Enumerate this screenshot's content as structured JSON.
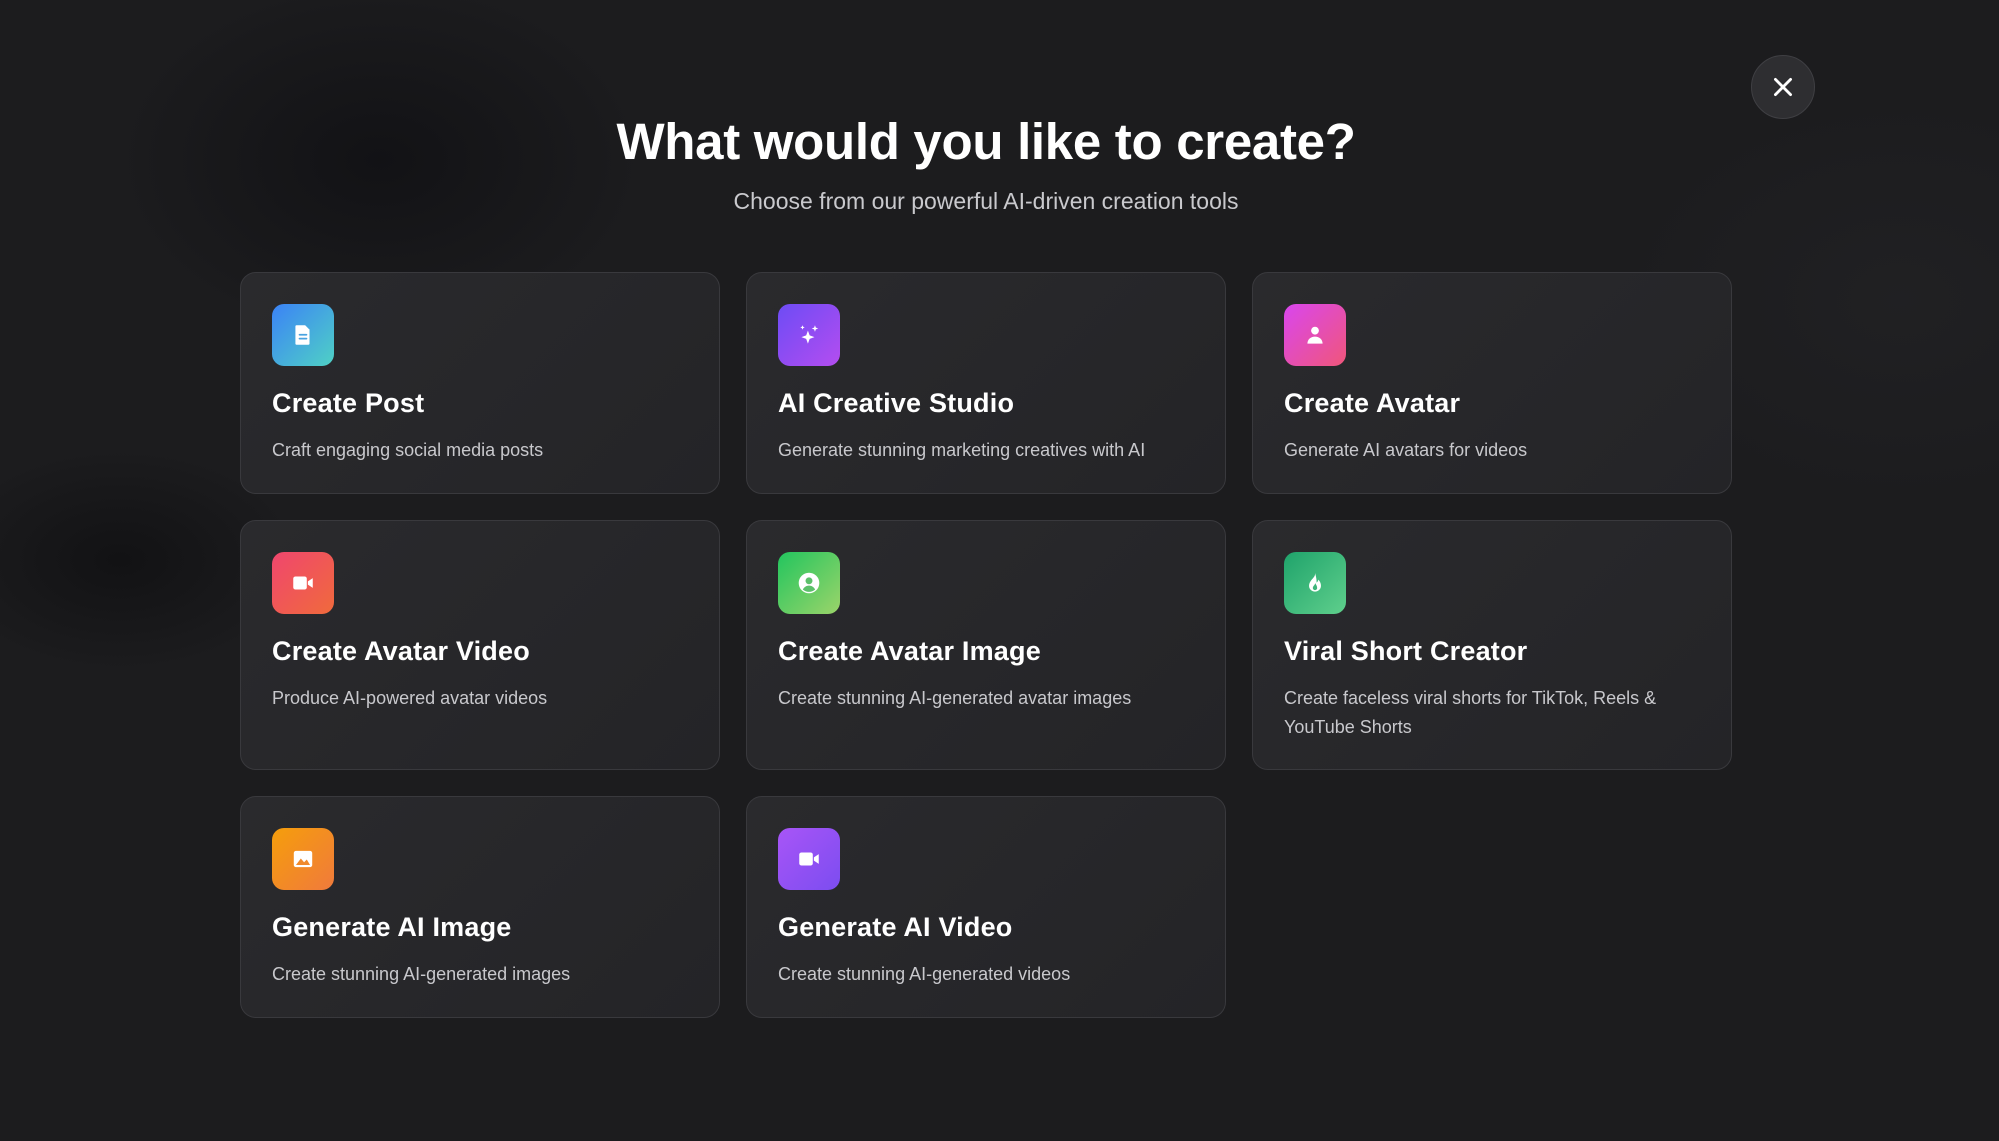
{
  "modal": {
    "title": "What would you like to create?",
    "subtitle": "Choose from our powerful AI-driven creation tools",
    "close_icon": "close-icon"
  },
  "cards": [
    {
      "title": "Create Post",
      "description": "Craft engaging social media posts",
      "icon": "document-icon",
      "gradient": [
        "#3b82f6",
        "#4fd1c5"
      ]
    },
    {
      "title": "AI Creative Studio",
      "description": "Generate stunning marketing creatives with AI",
      "icon": "sparkles-icon",
      "gradient": [
        "#6d4cf5",
        "#b44df0"
      ]
    },
    {
      "title": "Create Avatar",
      "description": "Generate AI avatars for videos",
      "icon": "user-icon",
      "gradient": [
        "#d946ef",
        "#f0567a"
      ]
    },
    {
      "title": "Create Avatar Video",
      "description": "Produce AI-powered avatar videos",
      "icon": "video-camera-icon",
      "gradient": [
        "#f0466e",
        "#f06a3c"
      ]
    },
    {
      "title": "Create Avatar Image",
      "description": "Create stunning AI-generated avatar images",
      "icon": "user-circle-icon",
      "gradient": [
        "#22c55e",
        "#9bd46a"
      ]
    },
    {
      "title": "Viral Short Creator",
      "description": "Create faceless viral shorts for TikTok, Reels & YouTube Shorts",
      "icon": "flame-icon",
      "gradient": [
        "#1fa36b",
        "#5fcf8c"
      ]
    },
    {
      "title": "Generate AI Image",
      "description": "Create stunning AI-generated images",
      "icon": "image-icon",
      "gradient": [
        "#f59e0b",
        "#f07a3c"
      ]
    },
    {
      "title": "Generate AI Video",
      "description": "Create stunning AI-generated videos",
      "icon": "video-camera-icon",
      "gradient": [
        "#a855f7",
        "#7c4df0"
      ]
    }
  ]
}
